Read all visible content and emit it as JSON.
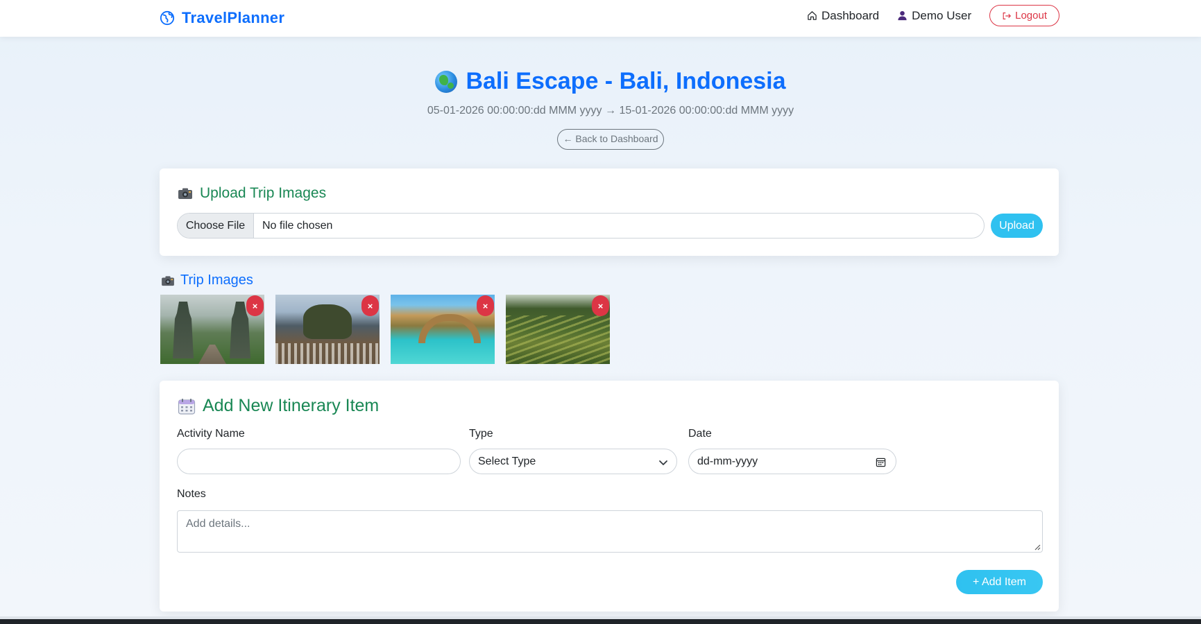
{
  "navbar": {
    "brand": "TravelPlanner",
    "dashboard_label": "Dashboard",
    "user_label": "Demo User",
    "logout_label": "Logout",
    "brand_color": "#0d6efd",
    "danger_color": "#dc3545"
  },
  "trip": {
    "title": "Bali Escape - Bali, Indonesia",
    "dates": "05-01-2026 00:00:00:dd MMM yyyy → 15-01-2026 00:00:00:dd MMM yyyy",
    "back_label": "← Back to Dashboard"
  },
  "upload": {
    "title": "Upload Trip Images",
    "choose_label": "Choose File",
    "file_status": "No file chosen",
    "upload_label": "Upload",
    "accent_color": "#2fc1f0"
  },
  "images": {
    "title": "Trip Images",
    "delete_label": "×",
    "items": [
      {
        "subject": "temple-gate"
      },
      {
        "subject": "sea-temple"
      },
      {
        "subject": "beach-arch"
      },
      {
        "subject": "rice-terraces"
      }
    ]
  },
  "itinerary": {
    "title": "Add New Itinerary Item",
    "activity_label": "Activity Name",
    "activity_value": "",
    "type_label": "Type",
    "type_selected": "Select Type",
    "date_label": "Date",
    "date_value": "dd-mm-yyyy",
    "notes_label": "Notes",
    "notes_placeholder": "Add details...",
    "add_label": "+ Add Item",
    "title_color": "#198754"
  },
  "icons": {
    "brand": "globe-icon",
    "dashboard": "house-icon",
    "user": "person-icon",
    "logout": "logout-icon",
    "upload": "camera-icon",
    "itinerary": "calendar-icon"
  }
}
